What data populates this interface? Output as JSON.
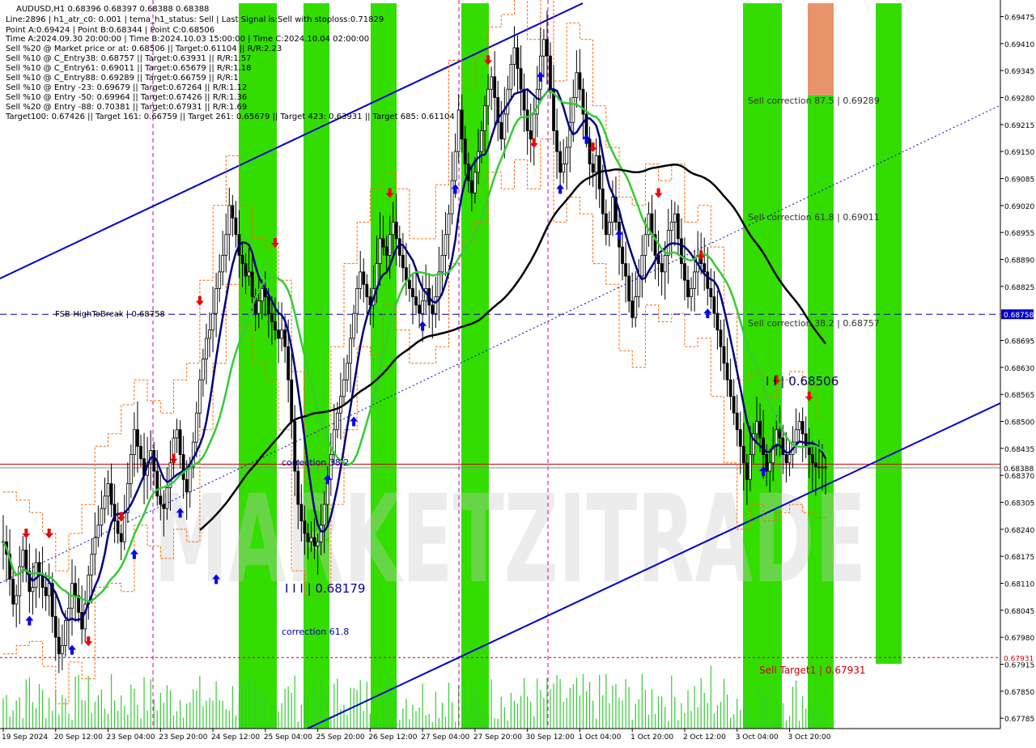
{
  "chart_data": {
    "type": "candlestick",
    "symbol_line": "AUDUSD,H1  0.68396 0.68397 0.68388 0.68388",
    "info_lines": [
      "Line:2896  |  h1_atr_c0: 0.001  |  tema_h1_status: Sell  |  Last Signal is:Sell with stoploss:0.71829",
      "Point A:0.69424  |  Point B:0.68344  |  Point C:0.68506",
      "Time A:2024.09.30 20:00:00  |  Time B:2024.10.03 15:00:00  |  Time C:2024.10.04 02:00:00",
      "Sell %20 @ Market price or at: 0.68506  ||  Target:0.61104  ||  R/R:2.23",
      "Sell %10 @ C_Entry38: 0.68757  ||  Target:0.63931  ||  R/R:1.57",
      "Sell %10 @ C_Entry61: 0.69011  ||  Target:0.65679  ||  R/R:1.18",
      "Sell %10 @ C_Entry88: 0.69289  ||  Target:0.66759  ||  R/R:1",
      "Sell %10 @ Entry -23: 0.69679  ||  Target:0.67264  ||  R/R:1.12",
      "Sell %10 @ Entry -50: 0.69964  ||  Target:0.67426  ||  R/R:1.36",
      "Sell %20 @ Entry -88: 0.70381  ||  Target:0.67931  ||  R/R:1.69",
      "Target100: 0.67426  ||  Target 161: 0.66759  ||  Target 261: 0.65679  ||  Target 423: 0.63931  ||  Target 685: 0.61104"
    ],
    "y_ticks": [
      0.69475,
      0.6941,
      0.69345,
      0.6928,
      0.69215,
      0.6915,
      0.69085,
      0.6902,
      0.68955,
      0.6889,
      0.68825,
      0.68758,
      0.68695,
      0.6863,
      0.68565,
      0.685,
      0.68435,
      0.68388,
      0.6837,
      0.68305,
      0.6824,
      0.68175,
      0.6811,
      0.68045,
      0.6798,
      0.67931,
      0.67915,
      0.6785,
      0.67785
    ],
    "y_tick_labels": [
      "0.69475",
      "0.69410",
      "0.69345",
      "0.69280",
      "0.69215",
      "0.69150",
      "0.69085",
      "0.69020",
      "0.68955",
      "0.68890",
      "0.68825",
      "",
      "0.68695",
      "0.68630",
      "0.68565",
      "0.68500",
      "0.68435",
      "",
      "0.68370",
      "0.68305",
      "0.68240",
      "0.68175",
      "0.68110",
      "0.68045",
      "0.67980",
      "",
      "0.67915",
      "0.67850",
      "0.67785"
    ],
    "ylim": [
      0.6776,
      0.69515
    ],
    "x_labels": [
      "19 Sep 2024",
      "20 Sep 12:00",
      "23 Sep 04:00",
      "23 Sep 20:00",
      "24 Sep 12:00",
      "25 Sep 04:00",
      "25 Sep 20:00",
      "26 Sep 12:00",
      "27 Sep 04:00",
      "27 Sep 20:00",
      "30 Sep 12:00",
      "1 Oct 04:00",
      "1 Oct 20:00",
      "2 Oct 12:00",
      "3 Oct 04:00",
      "3 Oct 20:00"
    ],
    "x_label_index": [
      0,
      16,
      32,
      48,
      64,
      80,
      96,
      112,
      128,
      144,
      160,
      176,
      192,
      208,
      224,
      240
    ],
    "bar_count": 252,
    "price_labels": {
      "current": "0.68388",
      "fsb": "0.68758",
      "sell_target": "0.67931"
    },
    "hlines": {
      "current": 0.68388,
      "current2": 0.68397,
      "fsb": 0.68758,
      "sell_target": 0.67931
    },
    "closes": [
      0.6821,
      0.6818,
      0.6812,
      0.6806,
      0.6808,
      0.6815,
      0.6819,
      0.6814,
      0.6809,
      0.681,
      0.6816,
      0.6813,
      0.681,
      0.6808,
      0.6811,
      0.6803,
      0.6798,
      0.6794,
      0.6796,
      0.6802,
      0.6805,
      0.6811,
      0.6808,
      0.6804,
      0.68,
      0.6806,
      0.6813,
      0.6818,
      0.6822,
      0.6825,
      0.6829,
      0.6832,
      0.6835,
      0.683,
      0.6826,
      0.6823,
      0.6821,
      0.6828,
      0.6835,
      0.6842,
      0.6848,
      0.6844,
      0.6841,
      0.6837,
      0.684,
      0.6843,
      0.6838,
      0.6832,
      0.683,
      0.6829,
      0.6834,
      0.684,
      0.6846,
      0.6848,
      0.6842,
      0.6836,
      0.6833,
      0.6839,
      0.6845,
      0.6852,
      0.686,
      0.6865,
      0.687,
      0.6872,
      0.6876,
      0.6882,
      0.6886,
      0.689,
      0.6895,
      0.6902,
      0.6899,
      0.6895,
      0.689,
      0.6888,
      0.6885,
      0.6886,
      0.688,
      0.6876,
      0.6879,
      0.6882,
      0.688,
      0.6876,
      0.6874,
      0.6872,
      0.687,
      0.6872,
      0.6868,
      0.686,
      0.685,
      0.6838,
      0.683,
      0.6826,
      0.6823,
      0.6821,
      0.6822,
      0.682,
      0.6821,
      0.6825,
      0.683,
      0.6836,
      0.6842,
      0.6848,
      0.6852,
      0.6856,
      0.686,
      0.6864,
      0.687,
      0.6876,
      0.6882,
      0.6886,
      0.6883,
      0.688,
      0.6878,
      0.6882,
      0.6888,
      0.6894,
      0.6892,
      0.689,
      0.6895,
      0.6898,
      0.6894,
      0.689,
      0.6887,
      0.6884,
      0.6882,
      0.688,
      0.6878,
      0.6876,
      0.6879,
      0.6882,
      0.6878,
      0.6876,
      0.688,
      0.6886,
      0.689,
      0.6895,
      0.69,
      0.6908,
      0.6915,
      0.6925,
      0.6918,
      0.6912,
      0.6908,
      0.6905,
      0.691,
      0.6915,
      0.692,
      0.6926,
      0.693,
      0.6933,
      0.6928,
      0.6922,
      0.6918,
      0.6924,
      0.693,
      0.6936,
      0.694,
      0.6935,
      0.693,
      0.6925,
      0.692,
      0.6918,
      0.6924,
      0.693,
      0.6938,
      0.6942,
      0.6938,
      0.693,
      0.692,
      0.6915,
      0.691,
      0.6912,
      0.6916,
      0.6922,
      0.6928,
      0.6934,
      0.693,
      0.6924,
      0.6918,
      0.6912,
      0.691,
      0.6914,
      0.6906,
      0.69,
      0.6895,
      0.6898,
      0.6904,
      0.6898,
      0.6892,
      0.6888,
      0.6885,
      0.6879,
      0.6875,
      0.688,
      0.6885,
      0.689,
      0.6895,
      0.69,
      0.6895,
      0.689,
      0.6888,
      0.6886,
      0.689,
      0.6896,
      0.6898,
      0.69,
      0.6894,
      0.6888,
      0.6884,
      0.688,
      0.6882,
      0.6886,
      0.689,
      0.6888,
      0.6886,
      0.6882,
      0.688,
      0.6876,
      0.6872,
      0.6868,
      0.6864,
      0.686,
      0.6856,
      0.6852,
      0.6848,
      0.6844,
      0.684,
      0.6836,
      0.6842,
      0.6847,
      0.685,
      0.6846,
      0.6842,
      0.6838,
      0.684,
      0.6844,
      0.6848,
      0.6846,
      0.6842,
      0.684,
      0.6842,
      0.6845,
      0.6848,
      0.685,
      0.6847,
      0.6844,
      0.6842,
      0.684,
      0.6839,
      0.68388,
      0.6839,
      0.68388
    ],
    "green_zones": [
      [
        295,
        342
      ],
      [
        375,
        407
      ],
      [
        458,
        490
      ],
      [
        570,
        604
      ],
      [
        918,
        966
      ],
      [
        998,
        1030
      ],
      [
        1082,
        1114
      ]
    ],
    "orange_zone": [
      998,
      1030
    ],
    "magenta_lines_x": [
      189,
      567,
      677
    ],
    "labels": {
      "sell_correction_875": "Sell correction 87.5 | 0.69289",
      "sell_correction_618": "Sell correction 61.8 | 0.69011",
      "sell_correction_382": "Sell correction 38.2 | 0.68757",
      "fsb": "FSB-HighToBreak | 0.68758",
      "point_c": "I I | 0.68506",
      "point_b": "I I I | 0.68179",
      "corr_382": "correction 38.2",
      "corr_618": "correction 61.8",
      "sell_target": "Sell Target1 | 0.67931",
      "watermark": "MARKETZITRADE"
    }
  },
  "colors": {
    "green_zone": "#33dd00",
    "orange_zone": "#e8946a",
    "channel": "#0000cc",
    "ma_navy": "#000080",
    "ma_green": "#33cc33",
    "ma_black": "#000000",
    "current_line": "#cc0000",
    "fsb_line": "#0000aa",
    "band": "#ff6600",
    "magenta": "#cc00aa",
    "up_arrow": "#0000ee",
    "down_arrow": "#ee0000"
  }
}
